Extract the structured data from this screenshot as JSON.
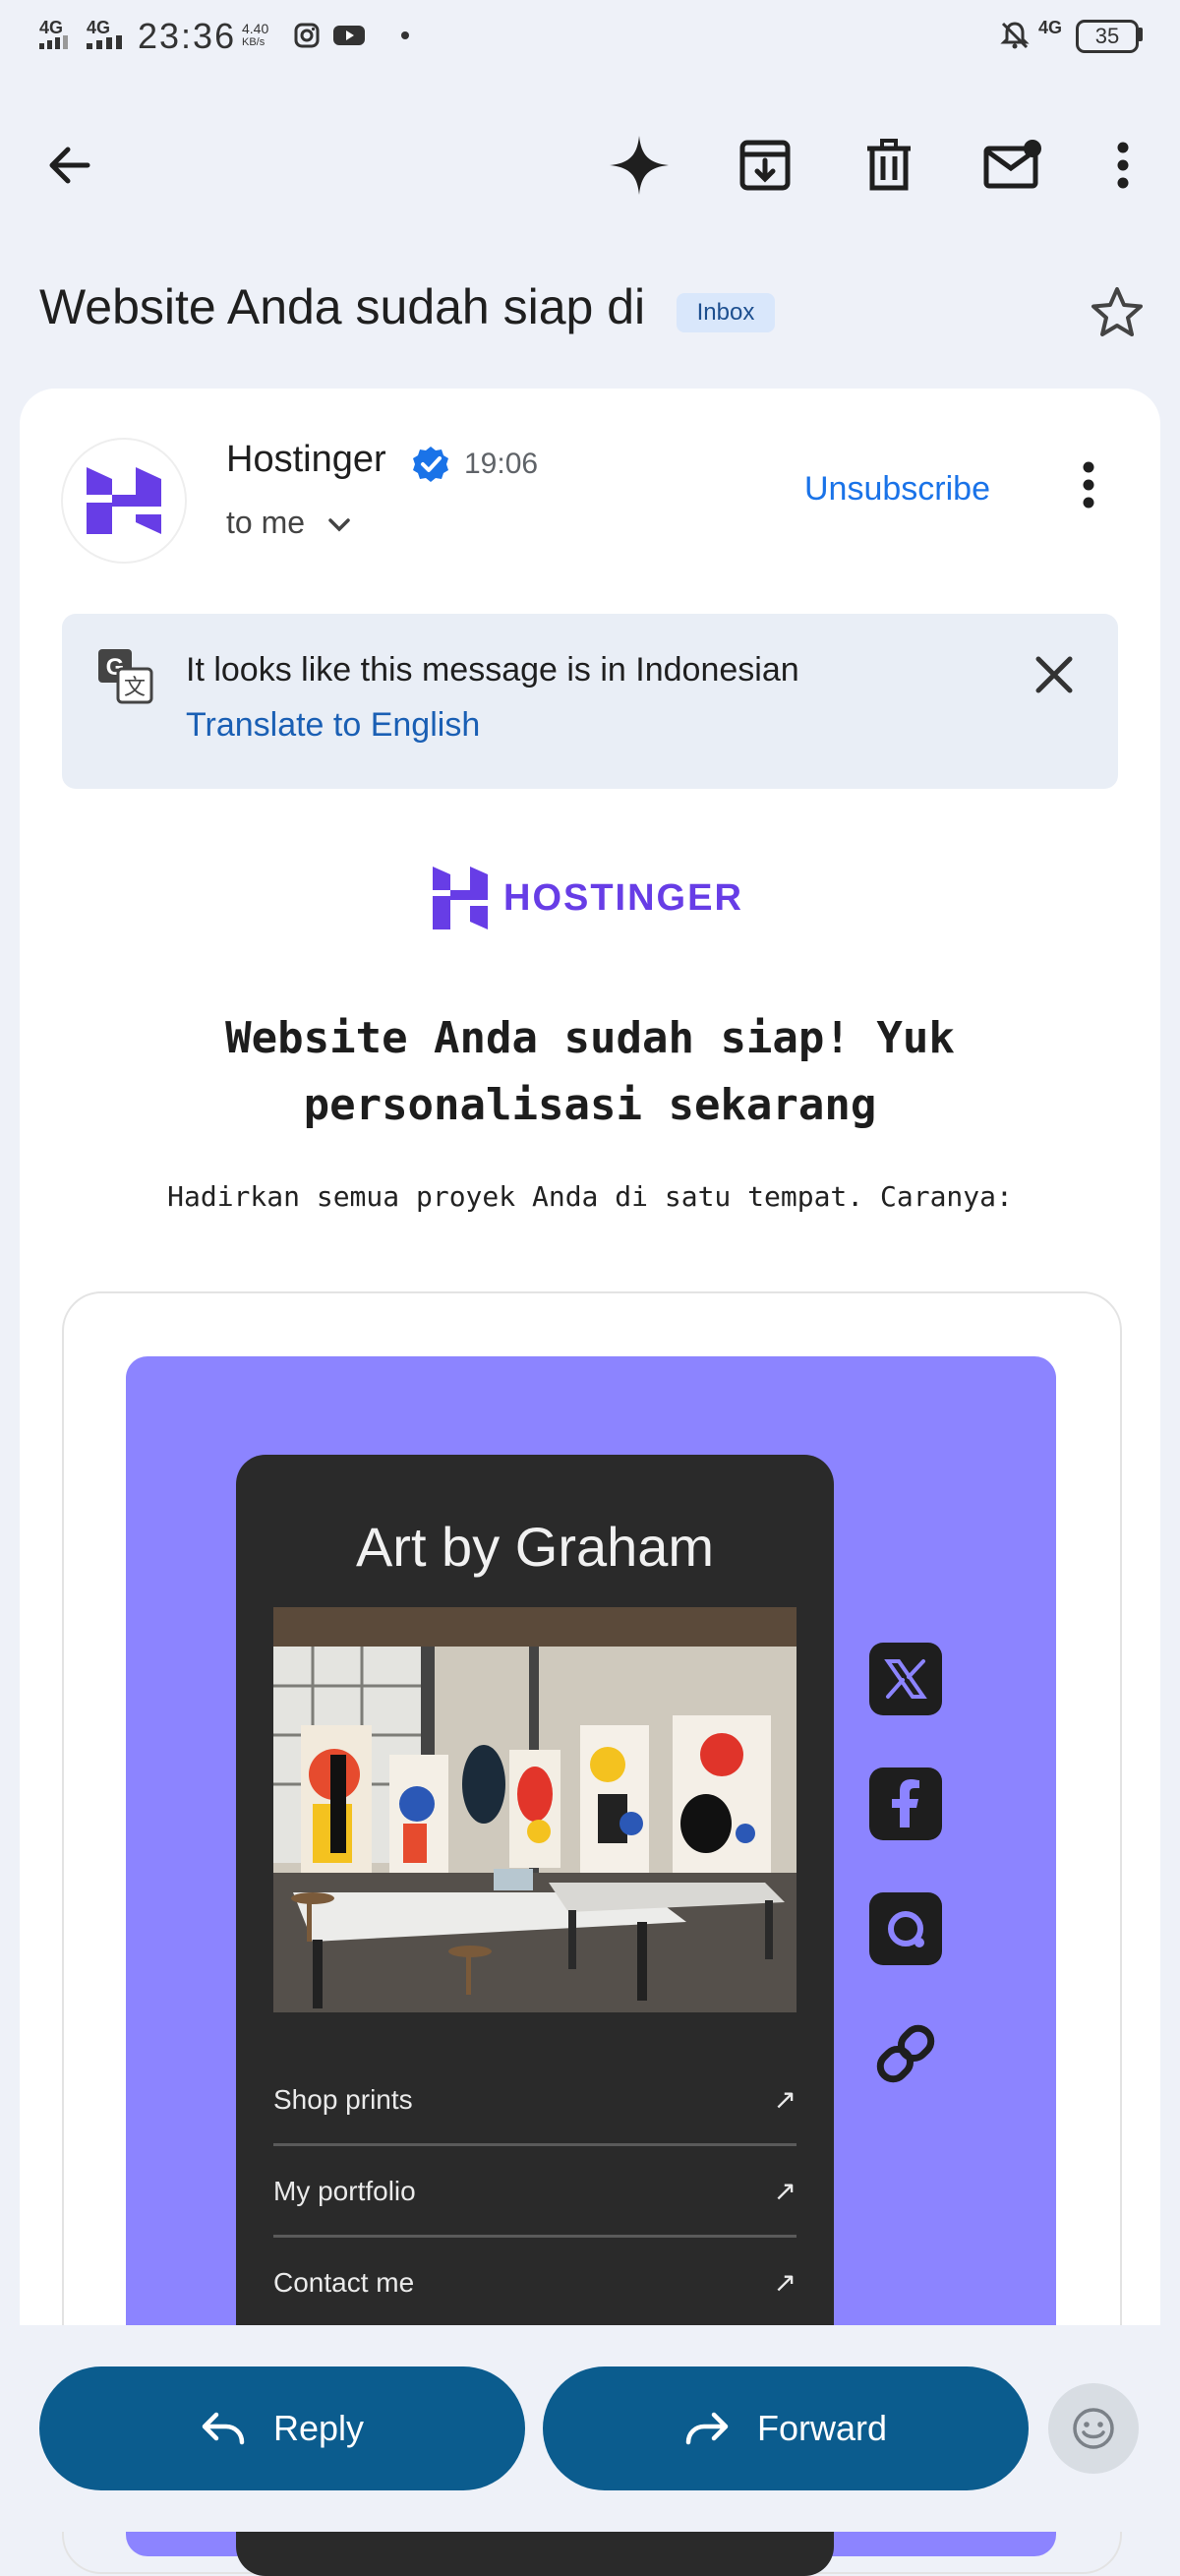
{
  "status_bar": {
    "time": "23:36",
    "net1": "4G",
    "net2": "4G",
    "speed_value": "4.40",
    "speed_unit": "KB/s",
    "net3": "4G",
    "battery": "35"
  },
  "email": {
    "subject": "Website Anda sudah siap di",
    "label": "Inbox",
    "sender": "Hostinger",
    "time": "19:06",
    "recipient": "to me",
    "unsubscribe": "Unsubscribe"
  },
  "translate_banner": {
    "message": "It looks like this message is in Indonesian",
    "link": "Translate to English"
  },
  "body": {
    "brand": "HOSTINGER",
    "headline_line1": "Website Anda sudah siap! Yuk",
    "headline_line2": "personalisasi sekarang",
    "subline": "Hadirkan semua proyek Anda di satu tempat. Caranya:",
    "preview": {
      "title": "Art by Graham",
      "links": [
        {
          "label": "Shop prints",
          "arrow": "↗"
        },
        {
          "label": "My portfolio",
          "arrow": "↗"
        },
        {
          "label": "Contact me",
          "arrow": "↗"
        }
      ]
    }
  },
  "actions": {
    "reply": "Reply",
    "forward": "Forward"
  },
  "colors": {
    "accent_blue": "#1a73e8",
    "brand_purple": "#673de6",
    "preview_bg": "#8c84ff",
    "action_button": "#0b5c8e"
  }
}
